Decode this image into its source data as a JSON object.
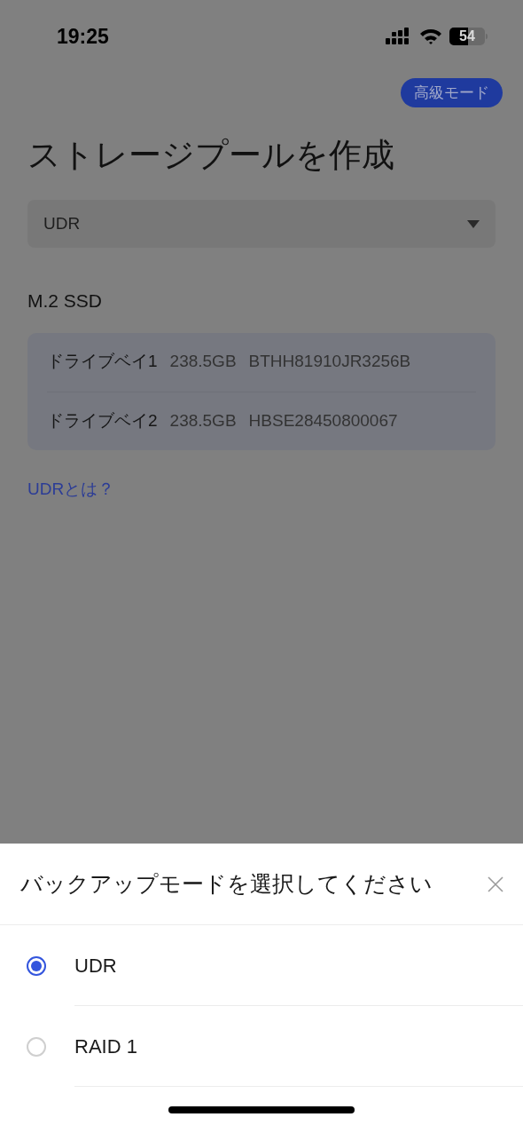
{
  "status_bar": {
    "time": "19:25",
    "battery": "54"
  },
  "advanced_button": "高級モード",
  "title": "ストレージプールを作成",
  "dropdown": {
    "value": "UDR"
  },
  "section": "M.2 SSD",
  "drives": [
    {
      "name": "ドライブベイ1",
      "size": "238.5GB",
      "serial": "BTHH81910JR3256B"
    },
    {
      "name": "ドライブベイ2",
      "size": "238.5GB",
      "serial": "HBSE28450800067"
    }
  ],
  "help_link": "UDRとは？",
  "sheet": {
    "title": "バックアップモードを選択してください",
    "options": [
      {
        "label": "UDR",
        "selected": true
      },
      {
        "label": "RAID 1",
        "selected": false
      }
    ]
  }
}
